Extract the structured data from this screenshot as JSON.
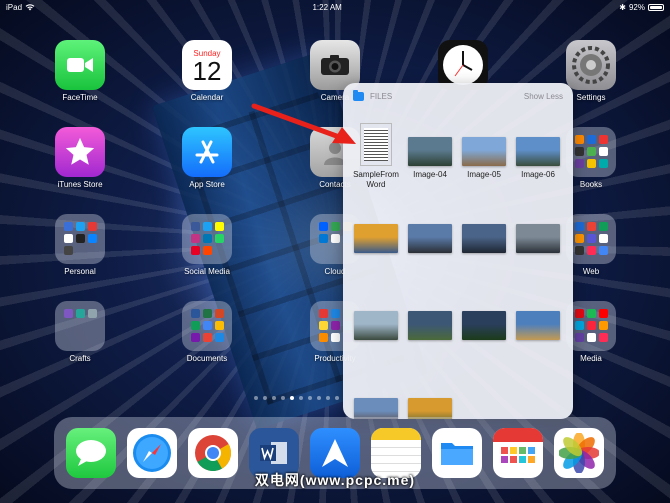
{
  "status": {
    "device": "iPad",
    "time": "1:22 AM",
    "battery": "92%"
  },
  "apps": {
    "facetime": "FaceTime",
    "calendar": "Calendar",
    "calendar_day": "Sunday",
    "calendar_date": "12",
    "camera": "Camera",
    "settings": "Settings",
    "itunes": "iTunes Store",
    "appstore": "App Store",
    "contacts": "Contacts",
    "books": "Books",
    "personal": "Personal",
    "socialmedia": "Social Media",
    "cloud": "Cloud",
    "web": "Web",
    "crafts": "Crafts",
    "documents": "Documents",
    "productivity": "Productivity",
    "media": "Media"
  },
  "files_popup": {
    "title": "FILES",
    "show_less": "Show Less",
    "items": [
      {
        "label": "SampleFrom Word",
        "kind": "document"
      },
      {
        "label": "Image-04",
        "kind": "image",
        "colors": [
          "#5b7a8f",
          "#2d4033"
        ]
      },
      {
        "label": "Image-05",
        "kind": "image",
        "colors": [
          "#7fa8d8",
          "#8a6b4a"
        ]
      },
      {
        "label": "Image-06",
        "kind": "image",
        "colors": [
          "#5f8fc9",
          "#3a4d3c"
        ]
      },
      {
        "label": "",
        "kind": "image",
        "colors": [
          "#e0a030",
          "#3a5a8a"
        ]
      },
      {
        "label": "",
        "kind": "image",
        "colors": [
          "#5a7aa8",
          "#2a2f35"
        ]
      },
      {
        "label": "",
        "kind": "image",
        "colors": [
          "#4a6388",
          "#1e2632"
        ]
      },
      {
        "label": "",
        "kind": "image",
        "colors": [
          "#7d8a96",
          "#2c3138"
        ]
      },
      {
        "label": "",
        "kind": "image",
        "colors": [
          "#9fb6c9",
          "#3b4a3f"
        ]
      },
      {
        "label": "",
        "kind": "image",
        "colors": [
          "#3c5676",
          "#4b6a3a"
        ]
      },
      {
        "label": "",
        "kind": "image",
        "colors": [
          "#2a3f5c",
          "#1c3b1a"
        ]
      },
      {
        "label": "",
        "kind": "image",
        "colors": [
          "#4d7fbd",
          "#c49a52"
        ]
      },
      {
        "label": "",
        "kind": "image",
        "colors": [
          "#6b8dbb",
          "#5b3b2a"
        ]
      },
      {
        "label": "",
        "kind": "image",
        "colors": [
          "#d79a2e",
          "#3f5b3a"
        ]
      }
    ]
  },
  "dock_icons": [
    "messages-icon",
    "safari-icon",
    "chrome-icon",
    "word-icon",
    "spark-icon",
    "notes-icon",
    "files-icon",
    "fantastical-icon",
    "photos-icon"
  ],
  "watermark": "双电网(www.pcpc.me)"
}
